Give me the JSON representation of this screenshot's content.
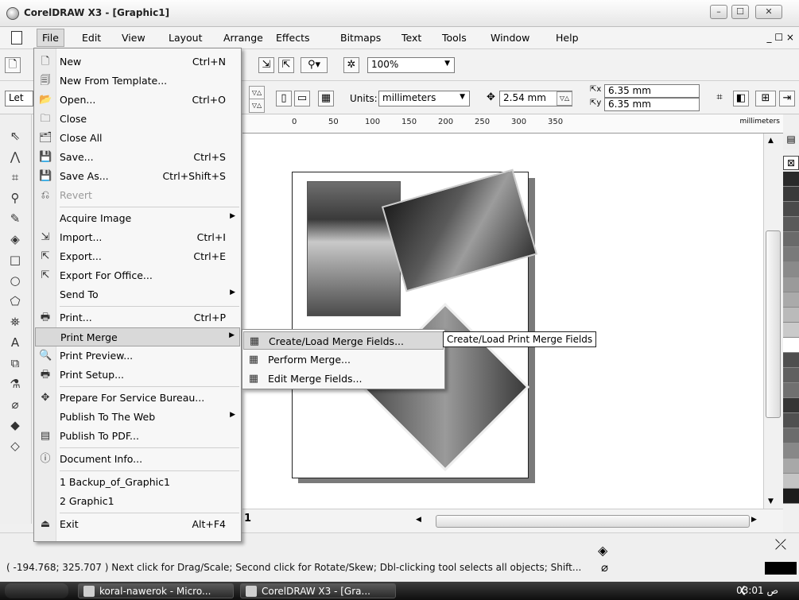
{
  "window": {
    "title": "CorelDRAW X3 - [Graphic1]"
  },
  "menubar": [
    "File",
    "Edit",
    "View",
    "Layout",
    "Arrange",
    "Effects",
    "Bitmaps",
    "Text",
    "Tools",
    "Window",
    "Help"
  ],
  "mdi_controls": "_ ☐ ×",
  "toolbar1": {
    "zoom": "100%"
  },
  "toolbar2": {
    "paper_type_partial": "Let",
    "units_label": "Units:",
    "units_value": "millimeters",
    "nudge_value": "2.54 mm",
    "dup_x": "6.35 mm",
    "dup_y": "6.35 mm"
  },
  "ruler": {
    "ticks": [
      "0",
      "50",
      "100",
      "150",
      "200",
      "250",
      "300",
      "350"
    ],
    "unit": "millimeters"
  },
  "page_tab": "1",
  "file_menu": [
    {
      "icon": "new-doc-icon",
      "glyph": "🗋",
      "label": "New",
      "shortcut": "Ctrl+N"
    },
    {
      "icon": "template-icon",
      "glyph": "🗐",
      "label": "New From Template...",
      "shortcut": ""
    },
    {
      "icon": "open-icon",
      "glyph": "📂",
      "label": "Open...",
      "shortcut": "Ctrl+O"
    },
    {
      "icon": "close-doc-icon",
      "glyph": "🗀",
      "label": "Close",
      "shortcut": ""
    },
    {
      "icon": "close-all-icon",
      "glyph": "🗂",
      "label": "Close All",
      "shortcut": ""
    },
    {
      "icon": "save-icon",
      "glyph": "💾",
      "label": "Save...",
      "shortcut": "Ctrl+S"
    },
    {
      "icon": "save-as-icon",
      "glyph": "💾",
      "label": "Save As...",
      "shortcut": "Ctrl+Shift+S"
    },
    {
      "icon": "revert-icon",
      "glyph": "⎌",
      "label": "Revert",
      "shortcut": "",
      "disabled": true
    },
    {
      "sep": true
    },
    {
      "icon": "",
      "glyph": "",
      "label": "Acquire Image",
      "shortcut": "",
      "submenu": true
    },
    {
      "icon": "import-icon",
      "glyph": "⇲",
      "label": "Import...",
      "shortcut": "Ctrl+I"
    },
    {
      "icon": "export-icon",
      "glyph": "⇱",
      "label": "Export...",
      "shortcut": "Ctrl+E"
    },
    {
      "icon": "export-office-icon",
      "glyph": "⇱",
      "label": "Export For Office...",
      "shortcut": ""
    },
    {
      "icon": "",
      "glyph": "",
      "label": "Send To",
      "shortcut": "",
      "submenu": true
    },
    {
      "sep": true
    },
    {
      "icon": "print-icon",
      "glyph": "🖶",
      "label": "Print...",
      "shortcut": "Ctrl+P"
    },
    {
      "icon": "",
      "glyph": "",
      "label": "Print Merge",
      "shortcut": "",
      "submenu": true,
      "highlight": true
    },
    {
      "icon": "print-preview-icon",
      "glyph": "🔍",
      "label": "Print Preview...",
      "shortcut": ""
    },
    {
      "icon": "print-setup-icon",
      "glyph": "🖶",
      "label": "Print Setup...",
      "shortcut": ""
    },
    {
      "sep": true
    },
    {
      "icon": "service-bureau-icon",
      "glyph": "✥",
      "label": "Prepare For Service Bureau...",
      "shortcut": ""
    },
    {
      "icon": "",
      "glyph": "",
      "label": "Publish To The Web",
      "shortcut": "",
      "submenu": true
    },
    {
      "icon": "pdf-icon",
      "glyph": "▤",
      "label": "Publish To PDF...",
      "shortcut": ""
    },
    {
      "sep": true
    },
    {
      "icon": "info-icon",
      "glyph": "ⓘ",
      "label": "Document Info...",
      "shortcut": ""
    },
    {
      "sep": true
    },
    {
      "icon": "",
      "glyph": "",
      "label": "1 Backup_of_Graphic1",
      "shortcut": ""
    },
    {
      "icon": "",
      "glyph": "",
      "label": "2 Graphic1",
      "shortcut": ""
    },
    {
      "sep": true
    },
    {
      "icon": "exit-icon",
      "glyph": "⏏",
      "label": "Exit",
      "shortcut": "Alt+F4"
    }
  ],
  "print_merge_submenu": [
    {
      "label": "Create/Load Merge Fields...",
      "highlight": true
    },
    {
      "label": "Perform Merge..."
    },
    {
      "label": "Edit Merge Fields..."
    }
  ],
  "tooltip": "Create/Load Print Merge Fields",
  "status": {
    "coords": "( -194.768; 325.707 )   Next click for Drag/Scale; Second click for Rotate/Skew; Dbl-clicking tool selects all objects; Shift..."
  },
  "taskbar": {
    "tasks": [
      "koral-nawerok - Micro...",
      "CorelDRAW X3 - [Gra..."
    ],
    "clock": "03:01 ص"
  },
  "palette": [
    "#2a2a2a",
    "#3a3a3a",
    "#4a4a4a",
    "#5a5a5a",
    "#6a6a6a",
    "#7a7a7a",
    "#8a8a8a",
    "#9a9a9a",
    "#aaaaaa",
    "#bababa",
    "#cacaca",
    "#ffffff",
    "#4f4f4f",
    "#606060",
    "#707070",
    "#353535",
    "#505050",
    "#6c6c6c",
    "#888888",
    "#a8a8a8",
    "#c4c4c4",
    "#1c1c1c"
  ]
}
